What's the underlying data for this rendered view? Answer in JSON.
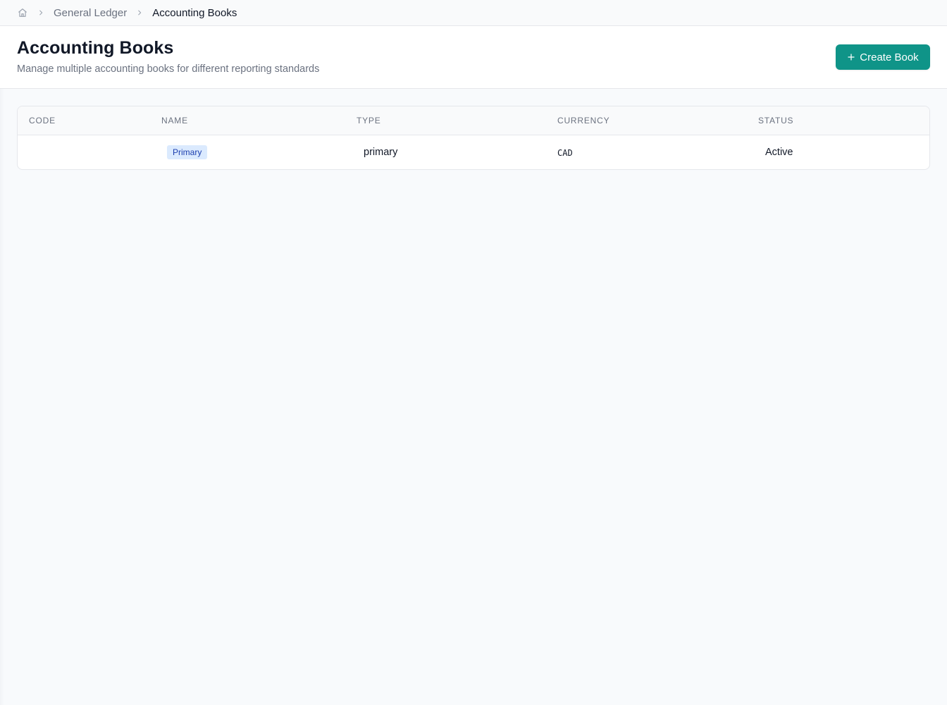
{
  "breadcrumb": {
    "items": [
      {
        "label": "General Ledger"
      },
      {
        "label": "Accounting Books"
      }
    ],
    "icons": {
      "home": "home-icon",
      "separator": "chevron-right-icon"
    }
  },
  "header": {
    "title": "Accounting Books",
    "subtitle": "Manage multiple accounting books for different reporting standards",
    "create_button_label": "Create Book",
    "create_button_icon": "plus-icon"
  },
  "table": {
    "columns": [
      "CODE",
      "NAME",
      "TYPE",
      "CURRENCY",
      "STATUS"
    ],
    "rows": [
      {
        "code": "",
        "name_badge": "Primary",
        "type": "primary",
        "currency": "CAD",
        "status": "Active"
      }
    ]
  },
  "colors": {
    "accent": "#0f9488",
    "badge_bg": "#dbeafe",
    "badge_text": "#1e40af",
    "page_bg": "#f8fafc"
  }
}
